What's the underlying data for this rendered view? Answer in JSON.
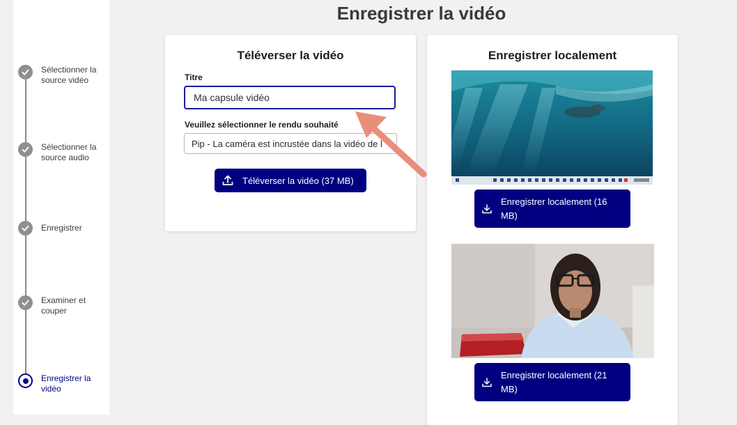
{
  "page": {
    "title": "Enregistrer la vidéo"
  },
  "steps": [
    {
      "label": "Sélectionner la source vidéo",
      "state": "done"
    },
    {
      "label": "Sélectionner la source audio",
      "state": "done"
    },
    {
      "label": "Enregistrer",
      "state": "done"
    },
    {
      "label": "Examiner et couper",
      "state": "done"
    },
    {
      "label": "Enregistrer la vidéo",
      "state": "current"
    }
  ],
  "upload": {
    "heading": "Téléverser la vidéo",
    "title_label": "Titre",
    "title_value": "Ma capsule vidéo",
    "render_label": "Veuillez sélectionner le rendu souhaité",
    "render_value": "Pip - La caméra est incrustée dans la vidéo de l",
    "button_label": "Téléverser la vidéo (37 MB)"
  },
  "local": {
    "heading": "Enregistrer localement",
    "screen_button_label": "Enregistrer localement (16 MB)",
    "camera_button_label": "Enregistrer localement (21 MB)"
  },
  "colors": {
    "accent": "#000080",
    "arrow": "#e98e7b",
    "step_done": "#8f8f8f"
  }
}
